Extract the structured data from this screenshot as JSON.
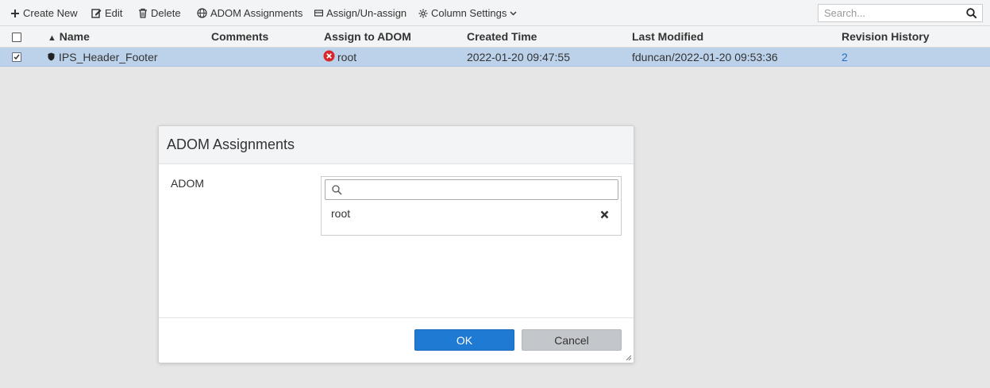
{
  "toolbar": {
    "create_new": "Create New",
    "edit": "Edit",
    "delete": "Delete",
    "adom_assignments": "ADOM Assignments",
    "assign_unassign": "Assign/Un-assign",
    "column_settings": "Column Settings",
    "search_placeholder": "Search..."
  },
  "table": {
    "columns": [
      "Name",
      "Comments",
      "Assign to ADOM",
      "Created Time",
      "Last Modified",
      "Revision History"
    ],
    "sort_indicator": "▲",
    "rows": [
      {
        "checked": true,
        "name": "IPS_Header_Footer",
        "comments": "",
        "adom": "root",
        "created": "2022-01-20 09:47:55",
        "modified": "fduncan/2022-01-20 09:53:36",
        "revision": "2"
      }
    ]
  },
  "dialog": {
    "title": "ADOM Assignments",
    "field_label": "ADOM",
    "selected_items": [
      "root"
    ],
    "ok_label": "OK",
    "cancel_label": "Cancel"
  },
  "colors": {
    "selected_row": "#bcd2ea",
    "ok_button": "#1f7ad3",
    "error_icon": "#d9262b",
    "link": "#1f6fc2"
  }
}
